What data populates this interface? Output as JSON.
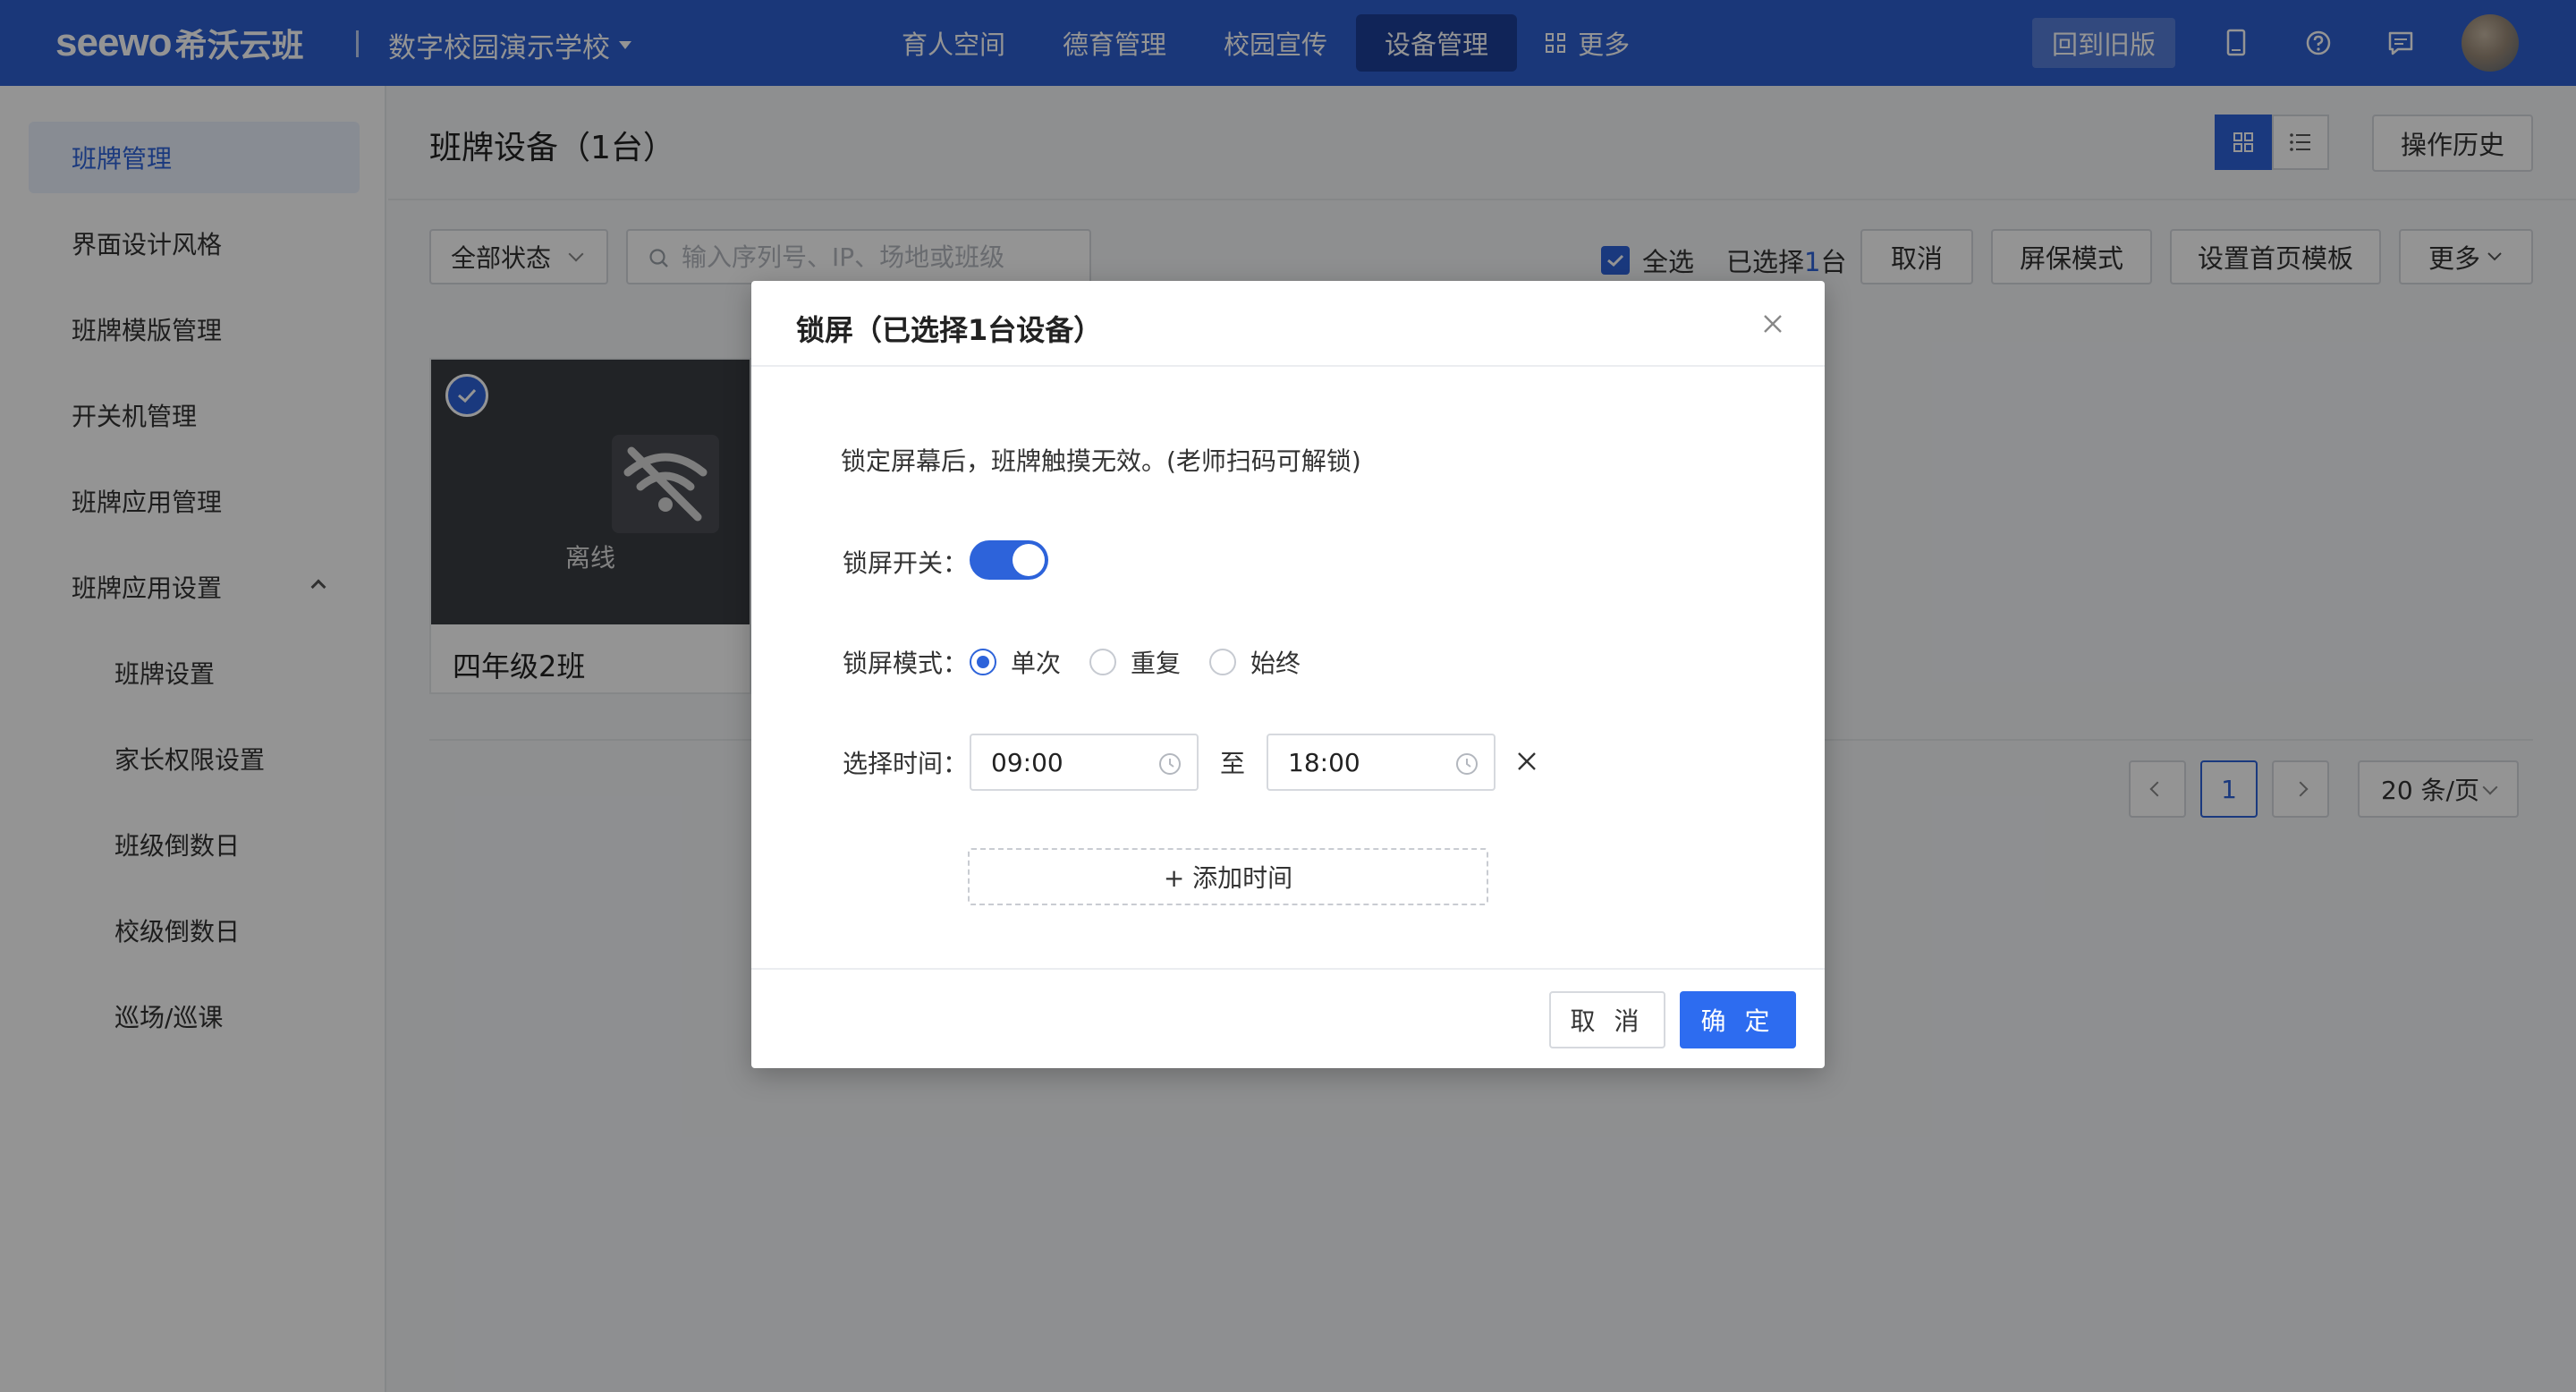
{
  "app": {
    "logo_en": "seewo",
    "logo_cn": "希沃云班",
    "school": "数字校园演示学校",
    "nav": [
      "育人空间",
      "德育管理",
      "校园宣传",
      "设备管理",
      "更多"
    ],
    "active_nav": "设备管理",
    "back_old": "回到旧版"
  },
  "sidebar": {
    "items": [
      {
        "label": "班牌管理",
        "active": true
      },
      {
        "label": "界面设计风格"
      },
      {
        "label": "班牌模版管理"
      },
      {
        "label": "开关机管理"
      },
      {
        "label": "班牌应用管理"
      },
      {
        "label": "班牌应用设置",
        "expanded": true
      },
      {
        "label": "班牌设置",
        "sub": true
      },
      {
        "label": "家长权限设置",
        "sub": true
      },
      {
        "label": "班级倒数日",
        "sub": true
      },
      {
        "label": "校级倒数日",
        "sub": true
      },
      {
        "label": "巡场/巡课",
        "sub": true
      }
    ]
  },
  "main": {
    "title": "班牌设备（1台）",
    "op_history": "操作历史",
    "status_filter": "全部状态",
    "search_placeholder": "输入序列号、IP、场地或班级",
    "select_all": "全选",
    "selected_prefix": "已选择",
    "selected_count": "1",
    "selected_suffix": "台",
    "buttons": {
      "cancel": "取消",
      "screensaver": "屏保模式",
      "home_template": "设置首页模板",
      "more": "更多"
    },
    "device": {
      "name": "四年级2班",
      "status": "离线",
      "selected": true
    },
    "pager": {
      "current": "1",
      "page_size": "20 条/页"
    }
  },
  "modal": {
    "title": "锁屏（已选择1台设备）",
    "desc": "锁定屏幕后，班牌触摸无效。(老师扫码可解锁)",
    "switch_label": "锁屏开关：",
    "switch_on": true,
    "mode_label": "锁屏模式：",
    "modes": [
      "单次",
      "重复",
      "始终"
    ],
    "selected_mode": "单次",
    "time_label": "选择时间：",
    "start_time": "09:00",
    "to": "至",
    "end_time": "18:00",
    "add_time": "+ 添加时间",
    "cancel": "取 消",
    "ok": "确 定"
  },
  "colors": {
    "primary": "#2e5fd1",
    "accent": "#2d63da",
    "confirm": "#2d6cf0"
  }
}
